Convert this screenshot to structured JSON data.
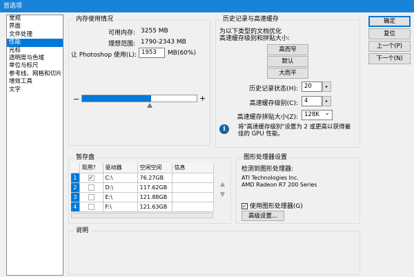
{
  "window": {
    "title": "首选项"
  },
  "sidebar": {
    "items": [
      {
        "label": "常规",
        "active": false
      },
      {
        "label": "界面",
        "active": false
      },
      {
        "label": "文件处理",
        "active": false
      },
      {
        "label": "性能",
        "active": true
      },
      {
        "label": "光标",
        "active": false
      },
      {
        "label": "透明度与色域",
        "active": false
      },
      {
        "label": "单位与标尺",
        "active": false
      },
      {
        "label": "参考线、网格和切片",
        "active": false
      },
      {
        "label": "增效工具",
        "active": false
      },
      {
        "label": "文字",
        "active": false
      }
    ]
  },
  "memory": {
    "title": "内存使用情况",
    "available_label": "可用内存:",
    "available_value": "3255 MB",
    "ideal_label": "理想范围:",
    "ideal_value": "1790-2343 MB",
    "use_label": "让 Photoshop 使用(L):",
    "use_value": "1953",
    "use_suffix": "MB(60%)",
    "minus": "−",
    "plus": "+",
    "slider_percent": 60
  },
  "history": {
    "title": "历史记录与高速缓存",
    "desc_line1": "为以下类型的文档优化",
    "desc_line2": "高速缓存级别和拼贴大小:",
    "btn_tall_thin": "高而窄",
    "btn_default": "默认",
    "btn_big_flat": "大而平",
    "states_label": "历史记录状态(H):",
    "states_value": "20",
    "cache_levels_label": "高速缓存级别(C):",
    "cache_levels_value": "4",
    "tile_size_label": "高速缓存拼贴大小(Z):",
    "tile_size_value": "128K",
    "info_text": "将\"高速缓存级别\"设置为 2 或更高以获得最佳的 GPU 性能。"
  },
  "scratch": {
    "title": "暂存盘",
    "columns": [
      "现用？",
      "驱动器",
      "空闲空间",
      "信息"
    ],
    "rows": [
      {
        "num": "1",
        "active": "✓",
        "drive": "C:\\",
        "free": "76.27GB",
        "info": ""
      },
      {
        "num": "2",
        "active": "",
        "drive": "D:\\",
        "free": "117.62GB",
        "info": ""
      },
      {
        "num": "3",
        "active": "",
        "drive": "E:\\",
        "free": "121.88GB",
        "info": ""
      },
      {
        "num": "4",
        "active": "",
        "drive": "F:\\",
        "free": "121.63GB",
        "info": ""
      }
    ]
  },
  "gpu": {
    "title": "图形处理器设置",
    "detected_label": "检测到图形处理器:",
    "vendor": "ATI Technologies Inc.",
    "model": "AMD Radeon R7 200 Series",
    "use_gpu_label": "使用图形处理器(G)",
    "use_gpu_checked": "✓",
    "advanced_button": "高级设置..."
  },
  "description": {
    "title": "说明"
  },
  "buttons": {
    "ok": "确定",
    "reset": "复位",
    "prev": "上一个(P)",
    "next": "下一个(N)"
  },
  "icons": {
    "up": "▲",
    "down": "▼",
    "spin": "▸",
    "dropdown": "⌄",
    "info": "i"
  }
}
